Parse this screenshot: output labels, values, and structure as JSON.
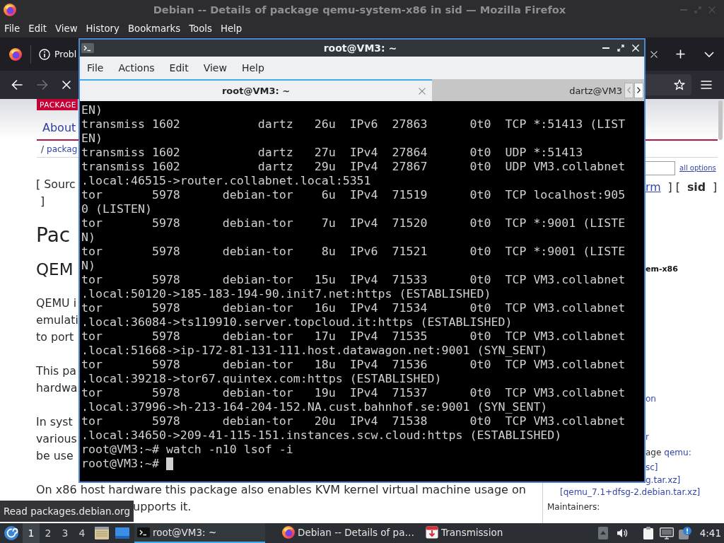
{
  "browser": {
    "title": "Debian -- Details of package qemu-system-x86 in sid — Mozilla Firefox",
    "menu": [
      "File",
      "Edit",
      "View",
      "History",
      "Bookmarks",
      "Tools",
      "Help"
    ],
    "tab": {
      "label": "Probl"
    },
    "page": {
      "banner": "PACKAGE",
      "nav_link": "About",
      "breadcrumb": {
        "separator": "/",
        "link": "packag"
      },
      "search_link": "all options",
      "source_lines": [
        "[ Sourc",
        "]"
      ],
      "heading": "Pac",
      "subheading": "QEM",
      "paragraphs": [
        [
          "QEMU i",
          "emulati",
          "to port"
        ],
        [
          "This pa",
          "hardwa"
        ],
        [
          "In syst",
          "various",
          "be use"
        ],
        [
          "On x86 host hardware this package also enables KVM kernel virtual machine usage on",
          "upports it."
        ]
      ],
      "suites": [
        {
          "kind": "link",
          "text": "rm"
        },
        {
          "kind": "plain",
          "text": "] ["
        },
        {
          "kind": "current",
          "text": "sid"
        },
        {
          "kind": "plain",
          "text": "]"
        }
      ],
      "sidebar": [
        {
          "kind": "heading",
          "text": "em-x86"
        },
        {
          "kind": "link",
          "text": "on"
        },
        {
          "kind": "link",
          "text": "r"
        },
        {
          "kind": "mixed",
          "text": "age",
          "link": "qemu:"
        },
        {
          "kind": "link",
          "text": "sc]"
        },
        {
          "kind": "link",
          "text": "g.tar.xz]"
        },
        {
          "kind": "link",
          "text": "[qemu_7.1+dfsg-2.debian.tar.xz]"
        },
        {
          "kind": "label",
          "text": "Maintainers:"
        }
      ]
    },
    "status_tooltip": "Read packages.debian.org"
  },
  "terminal": {
    "title": "root@VM3: ~",
    "menu": [
      "File",
      "Actions",
      "Edit",
      "View",
      "Help"
    ],
    "tabs": [
      {
        "label": "root@VM3: ~",
        "selected": true
      },
      {
        "label": "dartz@VM3",
        "selected": false
      }
    ],
    "lines": [
      "EN)",
      "transmiss 1602           dartz   26u  IPv6  27863      0t0  TCP *:51413 (LIST",
      "EN)",
      "transmiss 1602           dartz   27u  IPv4  27864      0t0  UDP *:51413",
      "transmiss 1602           dartz   29u  IPv4  27867      0t0  UDP VM3.collabnet",
      ".local:46515->router.collabnet.local:5351",
      "tor       5978      debian-tor    6u  IPv4  71519      0t0  TCP localhost:905",
      "0 (LISTEN)",
      "tor       5978      debian-tor    7u  IPv4  71520      0t0  TCP *:9001 (LISTE",
      "N)",
      "tor       5978      debian-tor    8u  IPv6  71521      0t0  TCP *:9001 (LISTE",
      "N)",
      "tor       5978      debian-tor   15u  IPv4  71533      0t0  TCP VM3.collabnet",
      ".local:50120->185-183-194-90.init7.net:https (ESTABLISHED)",
      "tor       5978      debian-tor   16u  IPv4  71534      0t0  TCP VM3.collabnet",
      ".local:36084->ts119910.server.topcloud.it:https (ESTABLISHED)",
      "tor       5978      debian-tor   17u  IPv4  71535      0t0  TCP VM3.collabnet",
      ".local:51668->ip-172-81-131-111.host.datawagon.net:9001 (SYN_SENT)",
      "tor       5978      debian-tor   18u  IPv4  71536      0t0  TCP VM3.collabnet",
      ".local:39218->tor67.quintex.com:https (ESTABLISHED)",
      "tor       5978      debian-tor   19u  IPv4  71537      0t0  TCP VM3.collabnet",
      ".local:37996->h-213-164-204-152.NA.cust.bahnhof.se:9001 (SYN_SENT)",
      "tor       5978      debian-tor   20u  IPv4  71538      0t0  TCP VM3.collabnet",
      ".local:34650->209-41-115-151.instances.scw.cloud:https (ESTABLISHED)",
      "root@VM3:~# watch -n10 lsof -i"
    ],
    "prompt": "root@VM3:~#",
    "cursor": true
  },
  "taskbar": {
    "workspaces": [
      {
        "label": "1",
        "selected": true
      },
      {
        "label": "2",
        "selected": false
      },
      {
        "label": "3",
        "selected": false
      },
      {
        "label": "4",
        "selected": false
      }
    ],
    "tasks": [
      {
        "kind": "terminal",
        "label": "root@VM3: ~",
        "selected": true
      },
      {
        "kind": "browser",
        "label": "Debian -- Details of pa…",
        "selected": false
      },
      {
        "kind": "torrent",
        "label": "Transmission",
        "selected": false
      }
    ],
    "clock": "4:41"
  }
}
